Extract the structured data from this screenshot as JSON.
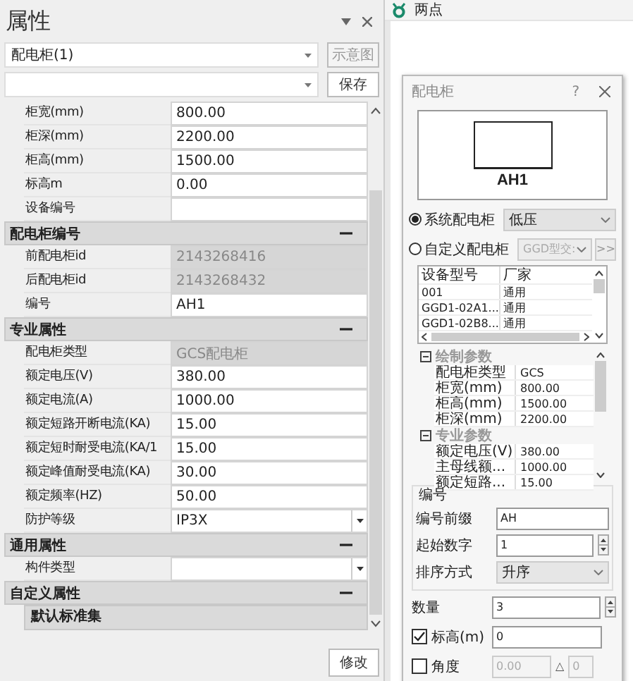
{
  "panel": {
    "title": "属性",
    "object_select": "配电柜(1)",
    "diagram_button": {
      "label": "示意图",
      "disabled": true
    },
    "save_button": "保存",
    "modify_button": "修改",
    "rows": [
      {
        "kind": "field",
        "label": "柜宽(mm)",
        "value": "800.00",
        "readonly": false,
        "dropdown": false
      },
      {
        "kind": "field",
        "label": "柜深(mm)",
        "value": "2200.00",
        "readonly": false,
        "dropdown": false
      },
      {
        "kind": "field",
        "label": "柜高(mm)",
        "value": "1500.00",
        "readonly": false,
        "dropdown": false
      },
      {
        "kind": "field",
        "label": "标高m",
        "value": "0.00",
        "readonly": false,
        "dropdown": false
      },
      {
        "kind": "field",
        "label": "设备编号",
        "readonly": false,
        "dropdown": false
      },
      {
        "kind": "section",
        "label": "配电柜编号",
        "expanded": true
      },
      {
        "kind": "field",
        "label": "前配电柜id",
        "value": "2143268416",
        "readonly": true,
        "dropdown": false
      },
      {
        "kind": "field",
        "label": "后配电柜id",
        "value": "2143268432",
        "readonly": true,
        "dropdown": false
      },
      {
        "kind": "field",
        "label": "编号",
        "value": "AH1",
        "readonly": false,
        "dropdown": false
      },
      {
        "kind": "section",
        "label": "专业属性",
        "expanded": true
      },
      {
        "kind": "field",
        "label": "配电柜类型",
        "value": "GCS配电柜",
        "readonly": true,
        "dropdown": false
      },
      {
        "kind": "field",
        "label": "额定电压(V)",
        "value": "380.00",
        "readonly": false,
        "dropdown": false
      },
      {
        "kind": "field",
        "label": "额定电流(A)",
        "value": "1000.00",
        "readonly": false,
        "dropdown": false
      },
      {
        "kind": "field",
        "label": "额定短路开断电流(KA)",
        "value": "15.00",
        "readonly": false,
        "dropdown": false
      },
      {
        "kind": "field",
        "label": "额定短时耐受电流(KA/1",
        "value": "15.00",
        "readonly": false,
        "dropdown": false
      },
      {
        "kind": "field",
        "label": "额定峰值耐受电流(KA)",
        "value": "30.00",
        "readonly": false,
        "dropdown": false
      },
      {
        "kind": "field",
        "label": "额定频率(HZ)",
        "value": "50.00",
        "readonly": false,
        "dropdown": false
      },
      {
        "kind": "field",
        "label": "防护等级",
        "value": "IP3X",
        "readonly": false,
        "dropdown": true
      },
      {
        "kind": "section",
        "label": "通用属性",
        "expanded": true
      },
      {
        "kind": "field",
        "label": "构件类型",
        "readonly": false,
        "dropdown": true
      },
      {
        "kind": "section",
        "label": "自定义属性",
        "expanded": true
      },
      {
        "kind": "subsection",
        "label": "默认标准集"
      }
    ]
  },
  "view": {
    "tab": "两点"
  },
  "dialog": {
    "title": "配电柜",
    "help": "?",
    "preview_label": "AH1",
    "sources": [
      {
        "label": "系统配电柜",
        "selected": true,
        "option": "低压",
        "disabled": false
      },
      {
        "label": "自定义配电柜",
        "selected": false,
        "option": "GGD型交:",
        "disabled": true
      }
    ],
    "more_button": ">>",
    "models": {
      "columns": [
        "设备型号",
        "厂家"
      ],
      "rows": [
        [
          "001",
          "通用"
        ],
        [
          "GGD1-02A1...",
          "通用"
        ],
        [
          "GGD1-02B8...",
          "通用"
        ]
      ]
    },
    "params": [
      {
        "label": "绘制参数",
        "expanded": true,
        "items": [
          {
            "name": "配电柜类型",
            "value": "GCS"
          },
          {
            "name": "柜宽(mm)",
            "value": "800.00"
          },
          {
            "name": "柜高(mm)",
            "value": "1500.00"
          },
          {
            "name": "柜深(mm)",
            "value": "2200.00"
          }
        ]
      },
      {
        "label": "专业参数",
        "expanded": true,
        "items": [
          {
            "name": "额定电压(V)",
            "value": "380.00"
          },
          {
            "name": "主母线额...",
            "value": "1000.00"
          },
          {
            "name": "额定短路...",
            "value": "15.00"
          }
        ]
      }
    ],
    "numbering": {
      "title": "编号",
      "prefix_label": "编号前缀",
      "prefix": "AH",
      "start_label": "起始数字",
      "start": "1",
      "order_label": "排序方式",
      "order": "升序"
    },
    "count_label": "数量",
    "count": "3",
    "elevation": {
      "label": "标高(m)",
      "checked": true,
      "value": "0"
    },
    "angle": {
      "label": "角度",
      "checked": false,
      "value": "0.00",
      "delta_symbol": "△",
      "delta": "0"
    }
  }
}
